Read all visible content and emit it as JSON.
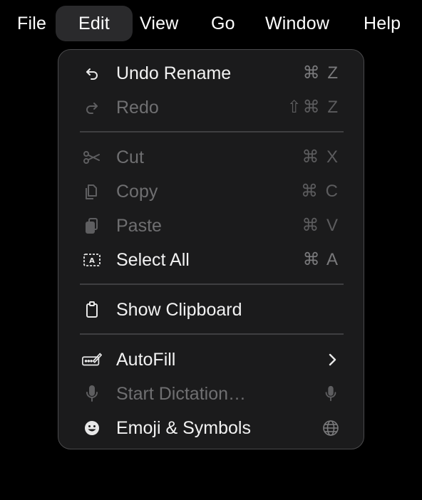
{
  "menubar": {
    "items": [
      {
        "label": "File"
      },
      {
        "label": "Edit",
        "active": true
      },
      {
        "label": "View"
      },
      {
        "label": "Go"
      },
      {
        "label": "Window"
      },
      {
        "label": "Help"
      }
    ]
  },
  "menu": {
    "items": [
      {
        "label": "Undo Rename",
        "shortcut": "⌘ Z",
        "icon": "undo-icon",
        "enabled": true
      },
      {
        "label": "Redo",
        "shortcut": "⇧⌘ Z",
        "icon": "redo-icon",
        "enabled": false
      },
      {
        "label": "Cut",
        "shortcut": "⌘ X",
        "icon": "scissors-icon",
        "enabled": false
      },
      {
        "label": "Copy",
        "shortcut": "⌘ C",
        "icon": "copy-icon",
        "enabled": false
      },
      {
        "label": "Paste",
        "shortcut": "⌘ V",
        "icon": "paste-icon",
        "enabled": false
      },
      {
        "label": "Select All",
        "shortcut": "⌘ A",
        "icon": "select-all-icon",
        "enabled": true
      },
      {
        "label": "Show Clipboard",
        "shortcut": "",
        "icon": "clipboard-icon",
        "enabled": true
      },
      {
        "label": "AutoFill",
        "shortcut": "",
        "icon": "autofill-icon",
        "enabled": true,
        "submenu": true
      },
      {
        "label": "Start Dictation…",
        "shortcut": "",
        "icon": "microphone-icon",
        "enabled": false,
        "trailing_icon": "microphone-icon"
      },
      {
        "label": "Emoji & Symbols",
        "shortcut": "",
        "icon": "emoji-icon",
        "enabled": true,
        "trailing_icon": "globe-icon"
      }
    ]
  },
  "colors": {
    "background": "#000000",
    "menu_background": "#1b1b1c",
    "menu_border": "#4a4a4c",
    "text_enabled": "#f2f2f2",
    "text_disabled": "#6f6f71",
    "shortcut": "#7a7a7c",
    "separator": "#3f3f41",
    "active_menubar": "#2a2a2c"
  }
}
